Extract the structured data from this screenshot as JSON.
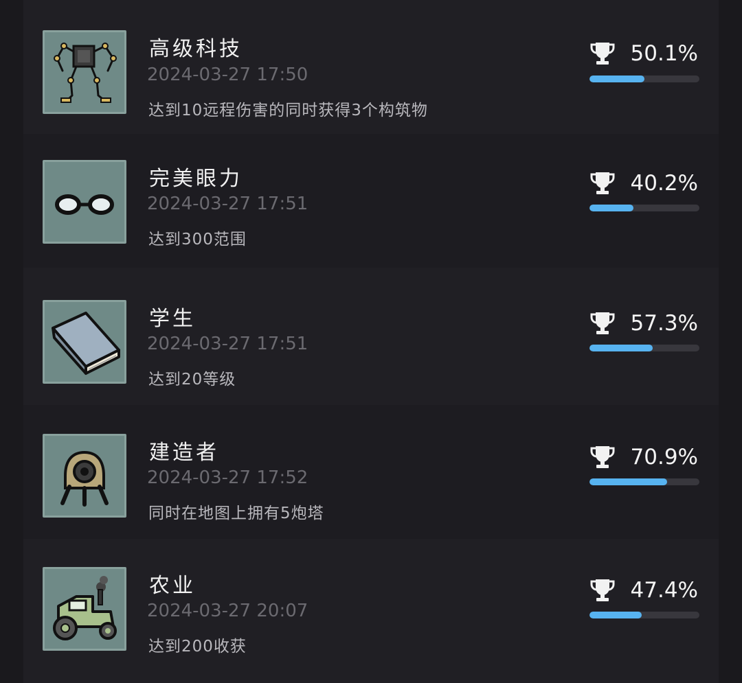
{
  "achievements": [
    {
      "title": "高级科技",
      "date": "2024-03-27 17:50",
      "description": "达到10远程伤害的同时获得3个构筑物",
      "percent_label": "50.1%",
      "percent": 50.1,
      "icon": "robot-walker-icon"
    },
    {
      "title": "完美眼力",
      "date": "2024-03-27 17:51",
      "description": "达到300范围",
      "percent_label": "40.2%",
      "percent": 40.2,
      "icon": "glasses-icon"
    },
    {
      "title": "学生",
      "date": "2024-03-27 17:51",
      "description": "达到20等级",
      "percent_label": "57.3%",
      "percent": 57.3,
      "icon": "book-icon"
    },
    {
      "title": "建造者",
      "date": "2024-03-27 17:52",
      "description": "同时在地图上拥有5炮塔",
      "percent_label": "70.9%",
      "percent": 70.9,
      "icon": "turret-icon"
    },
    {
      "title": "农业",
      "date": "2024-03-27 20:07",
      "description": "达到200收获",
      "percent_label": "47.4%",
      "percent": 47.4,
      "icon": "tractor-icon"
    }
  ],
  "colors": {
    "progress_fill": "#57b3f0",
    "progress_track": "#38373d",
    "icon_background": "#6f8a87"
  }
}
